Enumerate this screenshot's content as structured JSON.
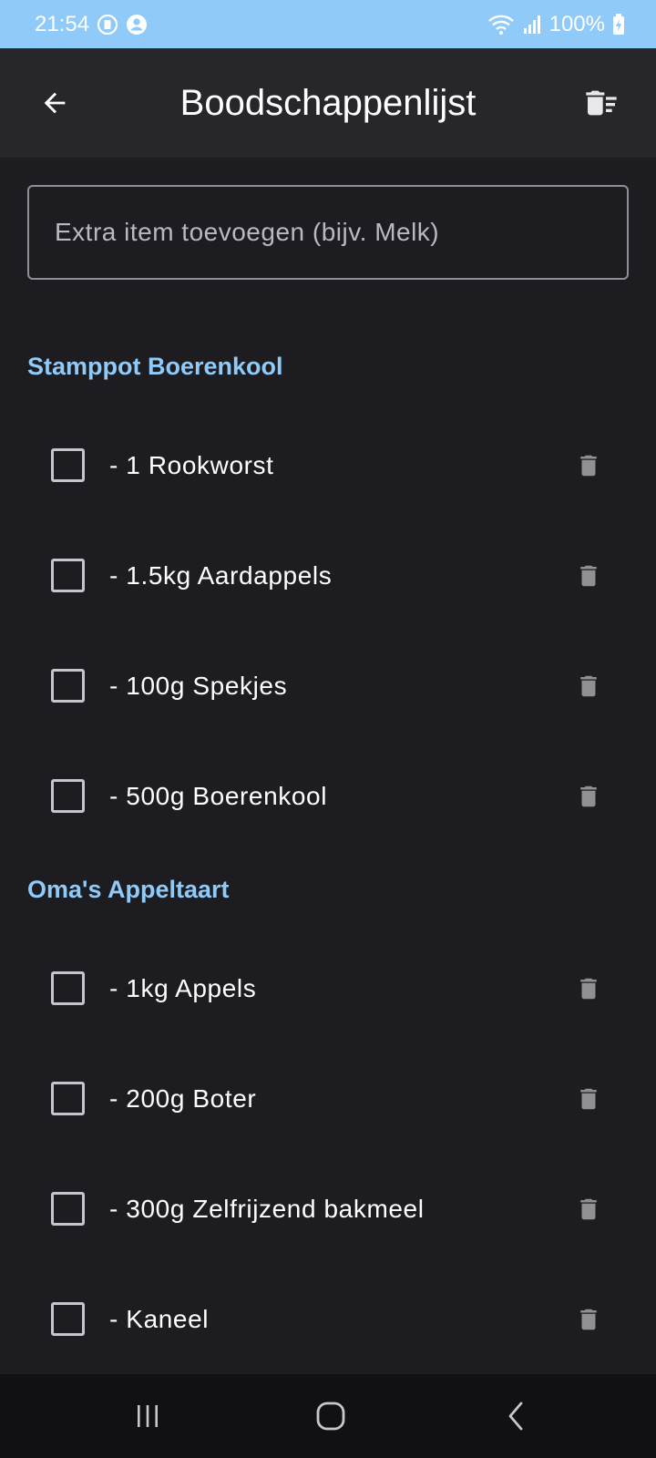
{
  "status_bar": {
    "time": "21:54",
    "battery": "100%"
  },
  "app_bar": {
    "title": "Boodschappenlijst",
    "back_icon": "arrow-back-icon",
    "clear_icon": "delete-sweep-icon"
  },
  "input": {
    "placeholder": "Extra item toevoegen (bijv. Melk)",
    "value": ""
  },
  "sections": [
    {
      "title": "Stamppot Boerenkool",
      "items": [
        {
          "label": "- 1 Rookworst",
          "checked": false
        },
        {
          "label": "- 1.5kg Aardappels",
          "checked": false
        },
        {
          "label": "- 100g Spekjes",
          "checked": false
        },
        {
          "label": "- 500g Boerenkool",
          "checked": false
        }
      ]
    },
    {
      "title": "Oma's Appeltaart",
      "items": [
        {
          "label": "- 1kg Appels",
          "checked": false
        },
        {
          "label": "- 200g Boter",
          "checked": false
        },
        {
          "label": "- 300g Zelfrijzend bakmeel",
          "checked": false
        },
        {
          "label": "- Kaneel",
          "checked": false
        }
      ]
    }
  ],
  "colors": {
    "accent": "#90caf9",
    "background": "#1d1d21",
    "app_bar": "#27272b",
    "icon_grey": "#8f8f94"
  }
}
